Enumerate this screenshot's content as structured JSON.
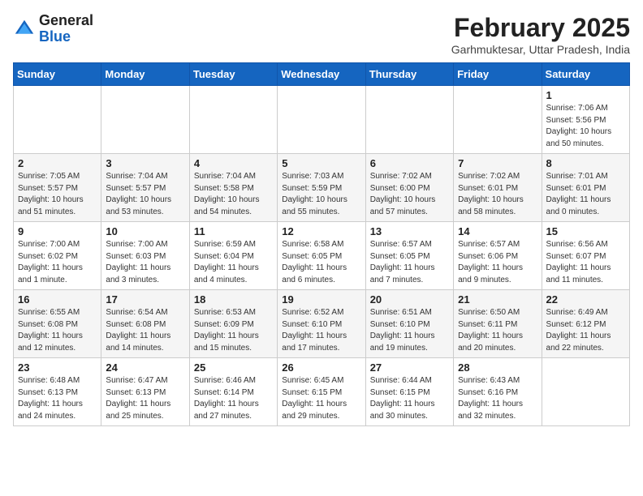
{
  "header": {
    "logo_general": "General",
    "logo_blue": "Blue",
    "month_title": "February 2025",
    "location": "Garhmuktesar, Uttar Pradesh, India"
  },
  "weekdays": [
    "Sunday",
    "Monday",
    "Tuesday",
    "Wednesday",
    "Thursday",
    "Friday",
    "Saturday"
  ],
  "weeks": [
    [
      {
        "day": "",
        "sunrise": "",
        "sunset": "",
        "daylight": ""
      },
      {
        "day": "",
        "sunrise": "",
        "sunset": "",
        "daylight": ""
      },
      {
        "day": "",
        "sunrise": "",
        "sunset": "",
        "daylight": ""
      },
      {
        "day": "",
        "sunrise": "",
        "sunset": "",
        "daylight": ""
      },
      {
        "day": "",
        "sunrise": "",
        "sunset": "",
        "daylight": ""
      },
      {
        "day": "",
        "sunrise": "",
        "sunset": "",
        "daylight": ""
      },
      {
        "day": "1",
        "sunrise": "Sunrise: 7:06 AM",
        "sunset": "Sunset: 5:56 PM",
        "daylight": "Daylight: 10 hours and 50 minutes."
      }
    ],
    [
      {
        "day": "2",
        "sunrise": "Sunrise: 7:05 AM",
        "sunset": "Sunset: 5:57 PM",
        "daylight": "Daylight: 10 hours and 51 minutes."
      },
      {
        "day": "3",
        "sunrise": "Sunrise: 7:04 AM",
        "sunset": "Sunset: 5:57 PM",
        "daylight": "Daylight: 10 hours and 53 minutes."
      },
      {
        "day": "4",
        "sunrise": "Sunrise: 7:04 AM",
        "sunset": "Sunset: 5:58 PM",
        "daylight": "Daylight: 10 hours and 54 minutes."
      },
      {
        "day": "5",
        "sunrise": "Sunrise: 7:03 AM",
        "sunset": "Sunset: 5:59 PM",
        "daylight": "Daylight: 10 hours and 55 minutes."
      },
      {
        "day": "6",
        "sunrise": "Sunrise: 7:02 AM",
        "sunset": "Sunset: 6:00 PM",
        "daylight": "Daylight: 10 hours and 57 minutes."
      },
      {
        "day": "7",
        "sunrise": "Sunrise: 7:02 AM",
        "sunset": "Sunset: 6:01 PM",
        "daylight": "Daylight: 10 hours and 58 minutes."
      },
      {
        "day": "8",
        "sunrise": "Sunrise: 7:01 AM",
        "sunset": "Sunset: 6:01 PM",
        "daylight": "Daylight: 11 hours and 0 minutes."
      }
    ],
    [
      {
        "day": "9",
        "sunrise": "Sunrise: 7:00 AM",
        "sunset": "Sunset: 6:02 PM",
        "daylight": "Daylight: 11 hours and 1 minute."
      },
      {
        "day": "10",
        "sunrise": "Sunrise: 7:00 AM",
        "sunset": "Sunset: 6:03 PM",
        "daylight": "Daylight: 11 hours and 3 minutes."
      },
      {
        "day": "11",
        "sunrise": "Sunrise: 6:59 AM",
        "sunset": "Sunset: 6:04 PM",
        "daylight": "Daylight: 11 hours and 4 minutes."
      },
      {
        "day": "12",
        "sunrise": "Sunrise: 6:58 AM",
        "sunset": "Sunset: 6:05 PM",
        "daylight": "Daylight: 11 hours and 6 minutes."
      },
      {
        "day": "13",
        "sunrise": "Sunrise: 6:57 AM",
        "sunset": "Sunset: 6:05 PM",
        "daylight": "Daylight: 11 hours and 7 minutes."
      },
      {
        "day": "14",
        "sunrise": "Sunrise: 6:57 AM",
        "sunset": "Sunset: 6:06 PM",
        "daylight": "Daylight: 11 hours and 9 minutes."
      },
      {
        "day": "15",
        "sunrise": "Sunrise: 6:56 AM",
        "sunset": "Sunset: 6:07 PM",
        "daylight": "Daylight: 11 hours and 11 minutes."
      }
    ],
    [
      {
        "day": "16",
        "sunrise": "Sunrise: 6:55 AM",
        "sunset": "Sunset: 6:08 PM",
        "daylight": "Daylight: 11 hours and 12 minutes."
      },
      {
        "day": "17",
        "sunrise": "Sunrise: 6:54 AM",
        "sunset": "Sunset: 6:08 PM",
        "daylight": "Daylight: 11 hours and 14 minutes."
      },
      {
        "day": "18",
        "sunrise": "Sunrise: 6:53 AM",
        "sunset": "Sunset: 6:09 PM",
        "daylight": "Daylight: 11 hours and 15 minutes."
      },
      {
        "day": "19",
        "sunrise": "Sunrise: 6:52 AM",
        "sunset": "Sunset: 6:10 PM",
        "daylight": "Daylight: 11 hours and 17 minutes."
      },
      {
        "day": "20",
        "sunrise": "Sunrise: 6:51 AM",
        "sunset": "Sunset: 6:10 PM",
        "daylight": "Daylight: 11 hours and 19 minutes."
      },
      {
        "day": "21",
        "sunrise": "Sunrise: 6:50 AM",
        "sunset": "Sunset: 6:11 PM",
        "daylight": "Daylight: 11 hours and 20 minutes."
      },
      {
        "day": "22",
        "sunrise": "Sunrise: 6:49 AM",
        "sunset": "Sunset: 6:12 PM",
        "daylight": "Daylight: 11 hours and 22 minutes."
      }
    ],
    [
      {
        "day": "23",
        "sunrise": "Sunrise: 6:48 AM",
        "sunset": "Sunset: 6:13 PM",
        "daylight": "Daylight: 11 hours and 24 minutes."
      },
      {
        "day": "24",
        "sunrise": "Sunrise: 6:47 AM",
        "sunset": "Sunset: 6:13 PM",
        "daylight": "Daylight: 11 hours and 25 minutes."
      },
      {
        "day": "25",
        "sunrise": "Sunrise: 6:46 AM",
        "sunset": "Sunset: 6:14 PM",
        "daylight": "Daylight: 11 hours and 27 minutes."
      },
      {
        "day": "26",
        "sunrise": "Sunrise: 6:45 AM",
        "sunset": "Sunset: 6:15 PM",
        "daylight": "Daylight: 11 hours and 29 minutes."
      },
      {
        "day": "27",
        "sunrise": "Sunrise: 6:44 AM",
        "sunset": "Sunset: 6:15 PM",
        "daylight": "Daylight: 11 hours and 30 minutes."
      },
      {
        "day": "28",
        "sunrise": "Sunrise: 6:43 AM",
        "sunset": "Sunset: 6:16 PM",
        "daylight": "Daylight: 11 hours and 32 minutes."
      },
      {
        "day": "",
        "sunrise": "",
        "sunset": "",
        "daylight": ""
      }
    ]
  ]
}
